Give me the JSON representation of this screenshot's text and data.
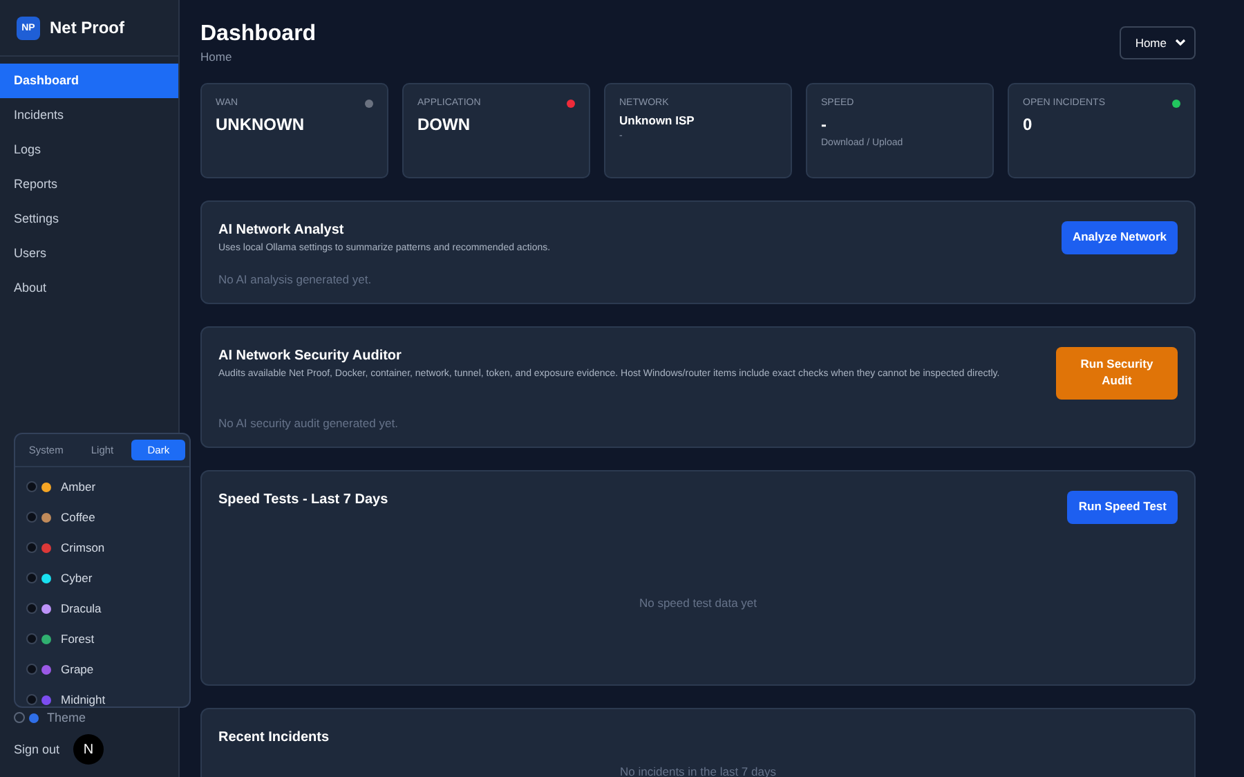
{
  "brand": {
    "name": "Net Proof",
    "logo": "NP"
  },
  "sidebar": {
    "items": [
      {
        "label": "Dashboard",
        "selected": true
      },
      {
        "label": "Incidents",
        "selected": false
      },
      {
        "label": "Logs",
        "selected": false
      },
      {
        "label": "Reports",
        "selected": false
      },
      {
        "label": "Settings",
        "selected": false
      },
      {
        "label": "Users",
        "selected": false
      },
      {
        "label": "About",
        "selected": false
      }
    ],
    "theme_label": "Theme",
    "sign_out": "Sign out",
    "dev_badge": "N"
  },
  "theme_menu": {
    "modes": [
      {
        "label": "System",
        "selected": false
      },
      {
        "label": "Light",
        "selected": false
      },
      {
        "label": "Dark",
        "selected": true
      }
    ],
    "themes": [
      {
        "name": "Amber",
        "color": "#f5a524"
      },
      {
        "name": "Coffee",
        "color": "#c08a5a"
      },
      {
        "name": "Crimson",
        "color": "#dc3838"
      },
      {
        "name": "Cyber",
        "color": "#19e0f0"
      },
      {
        "name": "Dracula",
        "color": "#bd93f9"
      },
      {
        "name": "Forest",
        "color": "#30b070"
      },
      {
        "name": "Grape",
        "color": "#9b59e6"
      },
      {
        "name": "Midnight",
        "color": "#7c4df0"
      }
    ]
  },
  "header": {
    "title": "Dashboard",
    "breadcrumb": "Home",
    "select": "Home"
  },
  "stats": [
    {
      "kind": "big",
      "label": "WAN",
      "value": "UNKNOWN",
      "color": "#6b7280"
    },
    {
      "kind": "big",
      "label": "APPLICATION",
      "value": "DOWN",
      "color": "#ef2b3a"
    },
    {
      "kind": "small",
      "label": "NETWORK",
      "value": "Unknown ISP",
      "sub": "-"
    },
    {
      "kind": "big",
      "label": "SPEED",
      "value": "-",
      "sub": "Download / Upload"
    },
    {
      "kind": "big",
      "label": "OPEN INCIDENTS",
      "value": "0",
      "color": "#22c55e"
    }
  ],
  "panels": [
    {
      "kind": "action",
      "title": "AI Network Analyst",
      "description": "Uses local Ollama settings to summarize patterns and recommended actions.",
      "empty": "No AI analysis generated yet.",
      "button": {
        "label": "Analyze Network",
        "kind": "primary"
      }
    },
    {
      "kind": "action",
      "title": "AI Network Security Auditor",
      "description": "Audits available Net Proof, Docker, container, network, tunnel, token, and exposure evidence. Host Windows/router items include exact checks when they cannot be inspected directly.",
      "empty": "No AI security audit generated yet.",
      "button": {
        "label": "Run Security Audit",
        "kind": "warning"
      }
    },
    {
      "kind": "chart",
      "title": "Speed Tests - Last 7 Days",
      "empty": "No speed test data yet",
      "button": {
        "label": "Run Speed Test",
        "kind": "primary"
      }
    },
    {
      "kind": "list",
      "title": "Recent Incidents",
      "empty": "No incidents in the last 7 days"
    }
  ]
}
